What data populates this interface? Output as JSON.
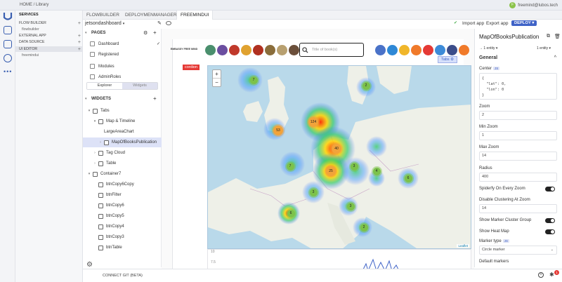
{
  "topbar": {
    "home": "HOME",
    "sep": "/",
    "library": "Library",
    "user": "freemind@lubos.tech",
    "avatar": "F"
  },
  "services": {
    "title": "SERVICES",
    "items": [
      {
        "label": "FLOW BUILDER",
        "sub": "flowbuilder"
      },
      {
        "label": "EXTERNAL APP"
      },
      {
        "label": "DATA SOURCE"
      },
      {
        "label": "UI EDITOR",
        "sub": "freemindui"
      }
    ]
  },
  "tabs": [
    "FLOWBUILDER",
    "DEPLOYMENMANAGER",
    "FREEMINDUI"
  ],
  "appbar": {
    "page_select": "jetsondashboard",
    "import": "Import app",
    "export": "Export app",
    "deploy": "DEPLOY"
  },
  "pages": {
    "title": "PAGES",
    "items": [
      "Dashboard",
      "Registered",
      "Modules",
      "AdminRoles"
    ],
    "seg_explorer": "Explorer",
    "seg_widgets": "Widgets"
  },
  "widgets": {
    "title": "WIDGETS",
    "items": [
      {
        "label": "Tabs",
        "indent": 0,
        "chev": "v",
        "sel": false
      },
      {
        "label": "Map & Timeline",
        "indent": 1,
        "chev": "v",
        "sel": false
      },
      {
        "label": "LargeAreaChart",
        "indent": 2,
        "chev": "",
        "sel": false
      },
      {
        "label": "MapOfBooksPublication",
        "indent": 2,
        "chev": ">",
        "sel": true
      },
      {
        "label": "Tag Cloud",
        "indent": 1,
        "chev": ">",
        "sel": false
      },
      {
        "label": "Table",
        "indent": 1,
        "chev": ">",
        "sel": false
      },
      {
        "label": "Container7",
        "indent": 0,
        "chev": "v",
        "sel": false
      },
      {
        "label": "btnCopy6Copy",
        "indent": 1,
        "chev": "",
        "sel": false
      },
      {
        "label": "btnFilter",
        "indent": 1,
        "chev": "",
        "sel": false
      },
      {
        "label": "btnCopy6",
        "indent": 1,
        "chev": "",
        "sel": false
      },
      {
        "label": "btnCopy5",
        "indent": 1,
        "chev": "",
        "sel": false
      },
      {
        "label": "btnCopy4",
        "indent": 1,
        "chev": "",
        "sel": false
      },
      {
        "label": "btnCopy3",
        "indent": 1,
        "chev": "",
        "sel": false
      },
      {
        "label": "btnTable",
        "indent": 1,
        "chev": "",
        "sel": false
      }
    ]
  },
  "canvas": {
    "logo": "EMBASSY FREE MIND",
    "search_placeholder": "Title of book(s)",
    "tabs_badge": "Tabs",
    "red_label": "cordion",
    "attribution": "Leaflet",
    "chart_ticks": [
      "10",
      "7.5"
    ]
  },
  "clusters": [
    {
      "label": "7",
      "cls": "g"
    },
    {
      "label": "2",
      "cls": "g"
    },
    {
      "label": "124",
      "cls": "o"
    },
    {
      "label": "53",
      "cls": "o"
    },
    {
      "label": "40",
      "cls": "o"
    },
    {
      "label": "25",
      "cls": "o"
    },
    {
      "label": "7",
      "cls": "g"
    },
    {
      "label": "3",
      "cls": "g"
    },
    {
      "label": "3",
      "cls": "g"
    },
    {
      "label": "4",
      "cls": "g"
    },
    {
      "label": "3",
      "cls": "g"
    },
    {
      "label": "6",
      "cls": "g"
    },
    {
      "label": "2",
      "cls": "g"
    },
    {
      "label": "6",
      "cls": "g"
    }
  ],
  "props": {
    "title": "MapOfBooksPublication",
    "entity_left": "1 entity",
    "entity_right": "1 entity",
    "section": "General",
    "center_label": "Center",
    "center_json": [
      "{",
      "  \"lat\": 0,",
      "  \"lon\": 0",
      "}"
    ],
    "zoom_label": "Zoom",
    "zoom": "2",
    "minzoom_label": "Min Zoom",
    "minzoom": "1",
    "maxzoom_label": "Max Zoom",
    "maxzoom": "14",
    "radius_label": "Radius",
    "radius": "400",
    "spider_label": "Spiderfy On Every Zoom",
    "disable_label": "Disable Clustering At Zoom",
    "disable": "14",
    "showmarker_label": "Show Marker Cluster Group",
    "heatmap_label": "Show Heat Map",
    "markertype_label": "Marker type",
    "markertype": "Circle marker",
    "default_label": "Default markers",
    "js": "JS"
  },
  "bottom": {
    "connect": "CONNECT GIT (BETA)",
    "notif_count": "1"
  },
  "colors": {
    "accent": "#3f63c7",
    "cluster_green": "#7cc24a",
    "cluster_orange": "#f2a33a"
  }
}
